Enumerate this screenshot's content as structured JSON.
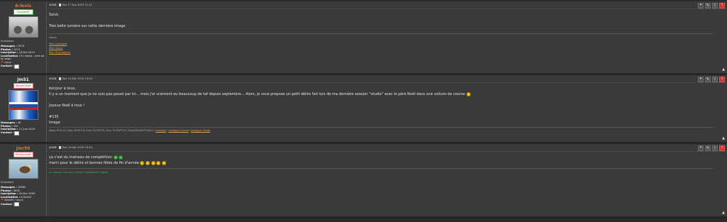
{
  "posts": [
    {
      "author": "A-lexis",
      "author_color": "#e0782a",
      "status": "Connecté",
      "rank": "Animateur",
      "stats": [
        {
          "k": "Messages :",
          "v": "2976"
        },
        {
          "k": "Photos :",
          "v": "1223"
        },
        {
          "k": "Inscription :",
          "v": "18 Mai 2014"
        },
        {
          "k": "Localisation :",
          "v": "En Valais - près de la neige"
        }
      ],
      "gift": "reçus",
      "contact": "Contact :",
      "number": "#123",
      "date": "Mar 17 Sep 2019 11:11",
      "lines": [
        "Salut,",
        "",
        "Très belle lumière sur cette dernière image"
      ],
      "sig_name": "Alexis",
      "sig_links": [
        "Mes paysages",
        "Mes essais",
        "Mon fil pompiers"
      ]
    },
    {
      "author": "jm51",
      "author_color": "#eeeeee",
      "status": "Déconnecté",
      "stats": [
        {
          "k": "Messages :",
          "v": "46"
        },
        {
          "k": "Photos :",
          "v": "109"
        },
        {
          "k": "Inscription :",
          "v": "11 Juin 2019"
        }
      ],
      "contact": "Contact :",
      "number": "#124",
      "date": "Mar 24 Déc 2019 13:03",
      "lines": [
        "bonjour à tous,",
        "Il y a un moment que je ne suis pas passé par ici... mais j'ai vraiment eu beaucoup de taf depuis septembre... Alors, je vous propose un petit délire fait lors de ma dernière session \"studio\" avec le père Noël dans une voiture de course",
        "",
        "Joyeux Noël à tous !",
        "",
        "#135",
        "Image"
      ],
      "sig_gear": "Alpha 7R III x2 | Sony 16-35 F4 | Sony 24-105 F4 | Sony 70-200 F2.8 | Sony200-600 F5.6-6.3 |",
      "sig_gear_links": [
        "Facebook",
        "Instagram Course",
        "Instagram Studio"
      ]
    },
    {
      "author": "jmr90",
      "author_color": "#e0782a",
      "status": "Déconnecté",
      "rank": "Animateur",
      "stats": [
        {
          "k": "Messages :",
          "v": "10680"
        },
        {
          "k": "Photos :",
          "v": "3632"
        },
        {
          "k": "Inscription :",
          "v": "04 Mar 2009"
        },
        {
          "k": "Localisation :",
          "v": "entreine"
        }
      ],
      "gift": "donnés / reçus",
      "contact": "Contact :",
      "number": "#125",
      "date": "Mar 24 Déc 2019 15:24",
      "lines": [
        "ça c'est du traineau de compétition",
        "merci pour le délire et bonnes fêtes de fin d'année"
      ],
      "sig_green": "au dessus mes bon critique hautement risqué"
    }
  ],
  "icons": {
    "quote": "quote-icon",
    "edit": "edit-icon",
    "info": "info-icon",
    "report": "report-icon",
    "up": "arrow-up-icon"
  }
}
